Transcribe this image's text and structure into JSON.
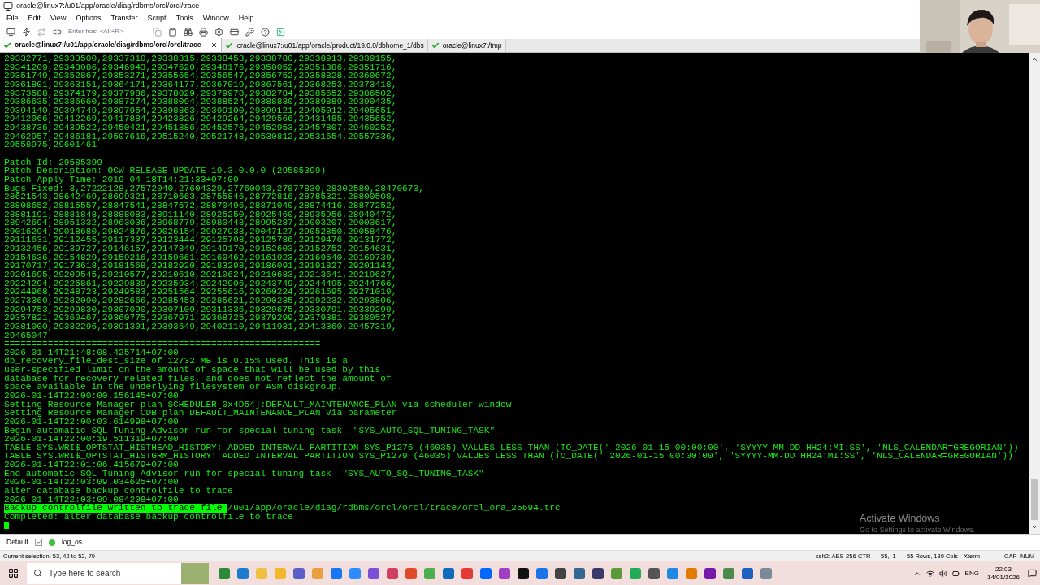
{
  "window": {
    "title": "oracle@linux7:/u01/app/oracle/diag/rdbms/orcl/orcl/trace"
  },
  "menu": [
    "File",
    "Edit",
    "View",
    "Options",
    "Transfer",
    "Script",
    "Tools",
    "Window",
    "Help"
  ],
  "toolbar": {
    "host_placeholder": "Enter host <Alt+R>"
  },
  "tabs": [
    {
      "label": "oracle@linux7:/u01/app/oracle/diag/rdbms/orcl/orcl/trace",
      "selected": true
    },
    {
      "label": "oracle@linux7:/u01/app/oracle/product/19.0.0/dbhome_1/dbs",
      "selected": false
    },
    {
      "label": "oracle@linux7:/tmp",
      "selected": false
    }
  ],
  "terminal": {
    "lines": [
      {
        "kind": "text",
        "text": "29332771,29333500,29337310,29338315,29338453,29338780,29338913,29339155,"
      },
      {
        "kind": "text",
        "text": "29341209,29343086,29346943,29347620,29348176,29350052,29351386,29351716,"
      },
      {
        "kind": "text",
        "text": "29351749,29352867,29353271,29355654,29356547,29356752,29358828,29360672,"
      },
      {
        "kind": "text",
        "text": "29361801,29363151,29364171,29364177,29367019,29367561,29368253,29373418,"
      },
      {
        "kind": "text",
        "text": "29373588,29374179,29377986,29378029,29379978,29382784,29385652,29386502,"
      },
      {
        "kind": "text",
        "text": "29386635,29386660,29387274,29388094,29388524,29388830,29389889,29390435,"
      },
      {
        "kind": "text",
        "text": "29394140,29394749,29397954,29398863,29399100,29399121,29405012,29405651,"
      },
      {
        "kind": "text",
        "text": "29412066,29412269,29417884,29423826,29429264,29429566,29431485,29435652,"
      },
      {
        "kind": "text",
        "text": "29438736,29439522,29450421,29451386,29452576,29452953,29457807,29460252,"
      },
      {
        "kind": "text",
        "text": "29462957,29486181,29507616,29515240,29521748,29530812,29531654,29557336,"
      },
      {
        "kind": "text",
        "text": "29558975,29601461"
      },
      {
        "kind": "blank"
      },
      {
        "kind": "text",
        "text": "Patch Id: 29585399"
      },
      {
        "kind": "text",
        "text": "Patch Description: OCW RELEASE UPDATE 19.3.0.0.0 (29585399)"
      },
      {
        "kind": "text",
        "text": "Patch Apply Time: 2019-04-18T14:21:33+07:00"
      },
      {
        "kind": "text",
        "text": "Bugs Fixed: 3,27222128,27572040,27604329,27760043,27877830,28302580,28470673,"
      },
      {
        "kind": "text",
        "text": "28621543,28642469,28699321,28710663,28755846,28772816,28785321,28800508,"
      },
      {
        "kind": "text",
        "text": "28808652,28815557,28847541,28847572,28870496,28871040,28874416,28877252,"
      },
      {
        "kind": "text",
        "text": "28881191,28881848,28888083,28911140,28925250,28925460,28935956,28940472,"
      },
      {
        "kind": "text",
        "text": "28942694,28951332,28963036,28968779,28980448,28995287,29003207,29003617,"
      },
      {
        "kind": "text",
        "text": "29016294,29018680,29024876,29026154,29027933,29047127,29052850,29058476,"
      },
      {
        "kind": "text",
        "text": "29111631,29112455,29117337,29123444,29125708,29125786,29129476,29131772,"
      },
      {
        "kind": "text",
        "text": "29132456,29139727,29146157,29147849,29149170,29152603,29152752,29154631,"
      },
      {
        "kind": "text",
        "text": "29154636,29154829,29159216,29159661,29160462,29161923,29169540,29169739,"
      },
      {
        "kind": "text",
        "text": "29170717,29173618,29181568,29182920,29183298,29186091,29191827,29201143,"
      },
      {
        "kind": "text",
        "text": "29201695,29209545,29210577,29210610,29210624,29210683,29213641,29219627,"
      },
      {
        "kind": "text",
        "text": "29224294,29225861,29229839,29235934,29242906,29243749,29244495,29244766,"
      },
      {
        "kind": "text",
        "text": "29244968,29248723,29249583,29251564,29255616,29260224,29261695,29271019,"
      },
      {
        "kind": "text",
        "text": "29273360,29282090,29282666,29285453,29285621,29290235,29292232,29293806,"
      },
      {
        "kind": "text",
        "text": "29294753,29299830,29307090,29307109,29311336,29329675,29330791,29339299,"
      },
      {
        "kind": "text",
        "text": "29357821,29360467,29360775,29367971,29368725,29379299,29379381,29380527,"
      },
      {
        "kind": "text",
        "text": "29381000,29382296,29391301,29393649,29402110,29411931,29413360,29457319,"
      },
      {
        "kind": "text",
        "text": "29465047"
      },
      {
        "kind": "text",
        "text": "=========================================================="
      },
      {
        "kind": "text",
        "text": "2026-01-14T21:48:08.425714+07:00"
      },
      {
        "kind": "text",
        "text": "db_recovery_file_dest_size of 12732 MB is 0.15% used. This is a"
      },
      {
        "kind": "text",
        "text": "user-specified limit on the amount of space that will be used by this"
      },
      {
        "kind": "text",
        "text": "database for recovery-related files, and does not reflect the amount of"
      },
      {
        "kind": "text",
        "text": "space available in the underlying filesystem or ASM diskgroup."
      },
      {
        "kind": "text",
        "text": "2026-01-14T22:00:00.156145+07:00"
      },
      {
        "kind": "text",
        "text": "Setting Resource Manager plan SCHEDULER[0x4D54]:DEFAULT_MAINTENANCE_PLAN via scheduler window"
      },
      {
        "kind": "text",
        "text": "Setting Resource Manager CDB plan DEFAULT_MAINTENANCE_PLAN via parameter"
      },
      {
        "kind": "text",
        "text": "2026-01-14T22:00:03.614998+07:00"
      },
      {
        "kind": "text",
        "text": "Begin automatic SQL Tuning Advisor run for special tuning task  \"SYS_AUTO_SQL_TUNING_TASK\""
      },
      {
        "kind": "text",
        "text": "2026-01-14T22:00:19.511319+07:00"
      },
      {
        "kind": "text",
        "text": "TABLE SYS.WRI$_OPTSTAT_HISTHEAD_HISTORY: ADDED INTERVAL PARTITION SYS_P1276 (46035) VALUES LESS THAN (TO_DATE(' 2026-01-15 00:00:00', 'SYYYY-MM-DD HH24:MI:SS', 'NLS_CALENDAR=GREGORIAN'))"
      },
      {
        "kind": "text",
        "text": "TABLE SYS.WRI$_OPTSTAT_HISTGRM_HISTORY: ADDED INTERVAL PARTITION SYS_P1279 (46035) VALUES LESS THAN (TO_DATE(' 2026-01-15 00:00:00', 'SYYYY-MM-DD HH24:MI:SS', 'NLS_CALENDAR=GREGORIAN'))"
      },
      {
        "kind": "text",
        "text": "2026-01-14T22:01:06.415679+07:00"
      },
      {
        "kind": "text",
        "text": "End automatic SQL Tuning Advisor run for special tuning task  \"SYS_AUTO_SQL_TUNING_TASK\""
      },
      {
        "kind": "text",
        "text": "2026-01-14T22:03:09.034625+07:00"
      },
      {
        "kind": "text",
        "text": "alter database backup controlfile to trace"
      },
      {
        "kind": "text",
        "text": "2026-01-14T22:03:09.084208+07:00"
      },
      {
        "kind": "selection",
        "selected_text": "Backup controlfile written to trace file ",
        "text": "/u01/app/oracle/diag/rdbms/orcl/orcl/trace/orcl_ora_25694.trc"
      },
      {
        "kind": "text",
        "text": "Completed: alter database backup controlfile to trace"
      },
      {
        "kind": "cursor"
      }
    ]
  },
  "activation": {
    "title": "Activate Windows",
    "subtitle": "Go to Settings to activate Windows."
  },
  "session_bar": {
    "profile": "Default",
    "session": "log_os"
  },
  "status_bar": {
    "selection": "Current selection: 53, 42 to 52, 79",
    "cipher": "ssh2: AES-256-CTR",
    "position": "55,  1",
    "size": "55 Rows, 189 Cols",
    "emulation": "Xterm",
    "keys": [
      "CAP",
      "NUM"
    ]
  },
  "taskbar": {
    "search_placeholder": "Type here to search",
    "language": "ENG",
    "time": "22:03",
    "date": "14/01/2026"
  }
}
